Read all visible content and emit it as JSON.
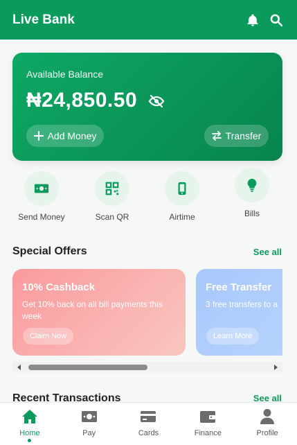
{
  "app": {
    "title": "Live Bank"
  },
  "colors": {
    "primary": "#0a9a5c",
    "primary_light": "#e6f4ec"
  },
  "header": {
    "icons": [
      "bell-icon",
      "search-icon"
    ]
  },
  "balance": {
    "label": "Available Balance",
    "amount": "₦24,850.50",
    "add_money_label": "Add Money",
    "transfer_label": "Transfer"
  },
  "quick_actions": [
    {
      "label": "Send Money",
      "icon": "money-icon"
    },
    {
      "label": "Scan QR",
      "icon": "qr-code-icon"
    },
    {
      "label": "Airtime",
      "icon": "phone-icon"
    },
    {
      "label": "Bills",
      "icon": "lightbulb-icon"
    }
  ],
  "offers_section": {
    "title": "Special Offers",
    "see_all": "See all"
  },
  "offers": [
    {
      "title": "10% Cashback",
      "description": "Get 10% back on all bill payments this week",
      "button": "Claim Now"
    },
    {
      "title": "Free Transfer",
      "description": "3 free transfers to a",
      "button": "Learn More"
    }
  ],
  "transactions_section": {
    "title": "Recent Transactions",
    "see_all": "See all"
  },
  "bottom_nav": [
    {
      "label": "Home",
      "icon": "home-icon",
      "active": true
    },
    {
      "label": "Pay",
      "icon": "money-icon",
      "active": false
    },
    {
      "label": "Cards",
      "icon": "credit-card-icon",
      "active": false
    },
    {
      "label": "Finance",
      "icon": "wallet-icon",
      "active": false
    },
    {
      "label": "Profile",
      "icon": "user-icon",
      "active": false
    }
  ]
}
